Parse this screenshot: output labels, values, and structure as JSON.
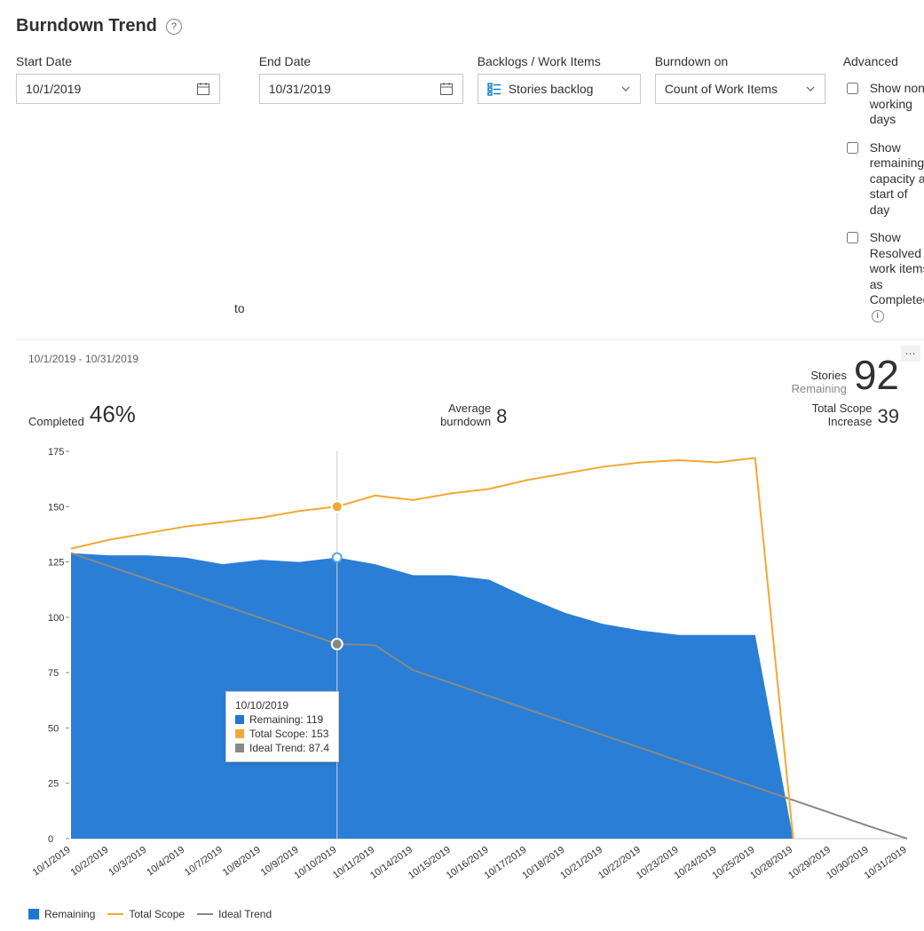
{
  "title": "Burndown Trend",
  "controls": {
    "start_label": "Start Date",
    "start_value": "10/1/2019",
    "to": "to",
    "end_label": "End Date",
    "end_value": "10/31/2019",
    "backlogs_label": "Backlogs / Work Items",
    "backlogs_value": "Stories backlog",
    "burndown_label": "Burndown on",
    "burndown_value": "Count of Work Items",
    "advanced_label": "Advanced",
    "adv1": "Show non-working days",
    "adv2": "Show remaining capacity at start of day",
    "adv3": "Show Resolved work items as Completed"
  },
  "summary": {
    "date_range": "10/1/2019 - 10/31/2019",
    "stories_label": "Stories",
    "remaining_label": "Remaining",
    "remaining_value": "92",
    "completed_label": "Completed",
    "completed_value": "46%",
    "avg_label1": "Average",
    "avg_label2": "burndown",
    "avg_value": "8",
    "scope_label1": "Total Scope",
    "scope_label2": "Increase",
    "scope_value": "39"
  },
  "tooltip": {
    "date": "10/10/2019",
    "remaining": "Remaining: 119",
    "total": "Total Scope: 153",
    "ideal": "Ideal Trend: 87.4"
  },
  "legend": {
    "remaining": "Remaining",
    "total": "Total Scope",
    "ideal": "Ideal Trend"
  },
  "chart_data": {
    "type": "area+line",
    "title": "Burndown Trend",
    "ylabel": "",
    "xlabel": "",
    "ylim": [
      0,
      175
    ],
    "categories": [
      "10/1/2019",
      "10/2/2019",
      "10/3/2019",
      "10/4/2019",
      "10/7/2019",
      "10/8/2019",
      "10/9/2019",
      "10/10/2019",
      "10/11/2019",
      "10/14/2019",
      "10/15/2019",
      "10/16/2019",
      "10/17/2019",
      "10/18/2019",
      "10/21/2019",
      "10/22/2019",
      "10/23/2019",
      "10/24/2019",
      "10/25/2019",
      "10/28/2019",
      "10/29/2019",
      "10/30/2019",
      "10/31/2019"
    ],
    "series": [
      {
        "name": "Remaining",
        "kind": "area",
        "color": "#1f77d4",
        "values": [
          129,
          128,
          128,
          127,
          124,
          126,
          125,
          127,
          124,
          119,
          119,
          117,
          109,
          102,
          97,
          94,
          92,
          92,
          92,
          0,
          null,
          null,
          null,
          null,
          null,
          null,
          null,
          null,
          null
        ]
      },
      {
        "name": "Total Scope",
        "kind": "line",
        "color": "#f2a934",
        "values": [
          131,
          135,
          138,
          141,
          143,
          145,
          148,
          150,
          155,
          153,
          156,
          158,
          162,
          165,
          168,
          170,
          171,
          170,
          172,
          0,
          null,
          null,
          null,
          null,
          null,
          null,
          null,
          null,
          null
        ]
      },
      {
        "name": "Ideal Trend",
        "kind": "line",
        "color": "#8a8886",
        "values": [
          129,
          123.1,
          117.3,
          111.4,
          105.5,
          99.6,
          93.8,
          87.9,
          87.4,
          76.1,
          70.3,
          64.4,
          58.5,
          52.6,
          46.8,
          40.9,
          35.0,
          29.1,
          23.3,
          17.4,
          11.5,
          5.6,
          0
        ]
      }
    ],
    "highlight_index": 7,
    "highlight": {
      "date": "10/10/2019",
      "Remaining": 119,
      "Total Scope": 153,
      "Ideal Trend": 87.4
    }
  }
}
